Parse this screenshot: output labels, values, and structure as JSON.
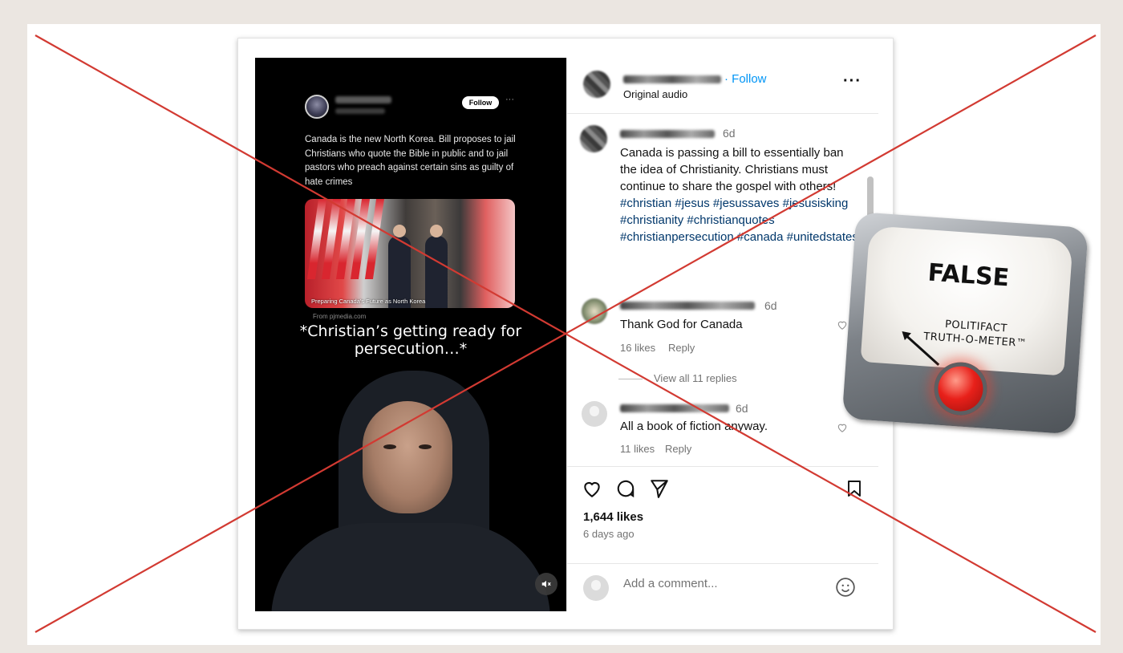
{
  "video": {
    "tweet": {
      "follow_label": "Follow",
      "more_label": "···",
      "text": "Canada is the new North Korea. Bill proposes to jail Christians who quote the Bible in public and to jail pastors who preach against certain sins as guilty of hate crimes",
      "image_caption": "Preparing Canada's Future as North Korea",
      "source": "From pjmedia.com"
    },
    "overlay_text": "*Christian’s getting ready for persecution…*",
    "mute_icon": "speaker-muted-icon"
  },
  "post": {
    "follow_label": "· Follow",
    "audio_label": "Original audio",
    "more_label": "···",
    "caption_time": "6d",
    "caption_text": "Canada is passing a bill to essentially ban the idea of Christianity. Christians must continue to share the gospel with others! ",
    "caption_tags": "#christian #jesus #jesussaves #jesusisking #christianity #christianquotes #christianpersecution #canada #unitedstates",
    "comments": [
      {
        "time": "6d",
        "text": "Thank God for Canada",
        "likes": "16 likes",
        "reply": "Reply"
      },
      {
        "time": "6d",
        "text": "All a book of fiction anyway.",
        "likes": "11 likes",
        "reply": "Reply"
      }
    ],
    "view_replies": "View all 11 replies",
    "likes_count": "1,644 likes",
    "time_ago": "6 days ago",
    "add_comment_placeholder": "Add a comment..."
  },
  "rating": {
    "label": "FALSE",
    "brand_line1": "POLITIFACT",
    "brand_line2": "TRUTH-O-METER™"
  },
  "colors": {
    "cross_lines": "#d23a32",
    "follow_blue": "#0095f6",
    "hashtag": "#00376b"
  }
}
